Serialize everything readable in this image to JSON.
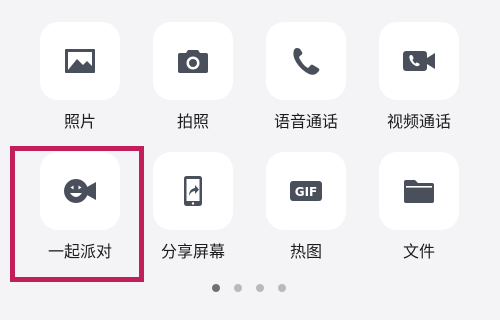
{
  "colors": {
    "background": "#f4f4f6",
    "tile": "#ffffff",
    "icon": "#4a4f5c",
    "highlight": "#c21f5a",
    "dot_active": "#6f6f74",
    "dot_inactive": "#b9b9bd"
  },
  "panel": {
    "rows": [
      [
        {
          "name": "photo",
          "label": "照片",
          "icon": "photo-icon"
        },
        {
          "name": "camera",
          "label": "拍照",
          "icon": "camera-icon"
        },
        {
          "name": "voice-call",
          "label": "语音通话",
          "icon": "phone-icon"
        },
        {
          "name": "video-call",
          "label": "视频通话",
          "icon": "video-call-icon"
        }
      ],
      [
        {
          "name": "party",
          "label": "一起派对",
          "icon": "party-camera-icon"
        },
        {
          "name": "share-screen",
          "label": "分享屏幕",
          "icon": "share-screen-icon"
        },
        {
          "name": "gif",
          "label": "热图",
          "icon": "gif-icon",
          "icon_text": "GIF"
        },
        {
          "name": "file",
          "label": "文件",
          "icon": "folder-icon"
        }
      ]
    ],
    "selected": "一起派对"
  },
  "pager": {
    "pages": 4,
    "current": 1
  }
}
